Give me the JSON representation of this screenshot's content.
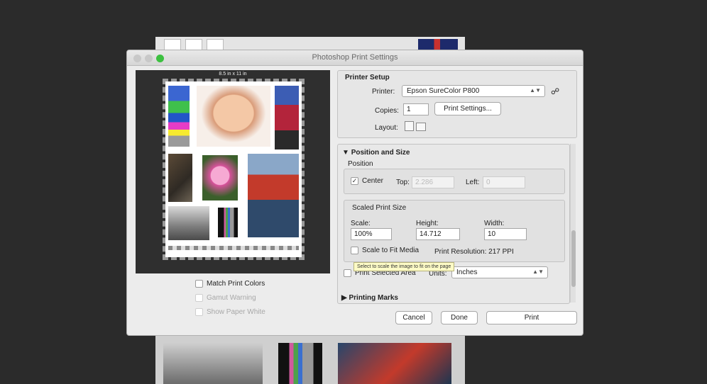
{
  "dialog": {
    "title": "Photoshop Print Settings"
  },
  "preview": {
    "paper_size": "8.5 in x 11 in",
    "match_print_colors": "Match Print Colors",
    "gamut_warning": "Gamut Warning",
    "show_paper_white": "Show Paper White"
  },
  "printer_setup": {
    "heading": "Printer Setup",
    "printer_label": "Printer:",
    "printer_value": "Epson SureColor P800",
    "copies_label": "Copies:",
    "copies_value": "1",
    "print_settings_button": "Print Settings...",
    "layout_label": "Layout:"
  },
  "position_size": {
    "heading": "Position and Size",
    "position_label": "Position",
    "center_label": "Center",
    "top_label": "Top:",
    "top_value": "2.286",
    "left_label": "Left:",
    "left_value": "0",
    "scaled_heading": "Scaled Print Size",
    "scale_label": "Scale:",
    "scale_value": "100%",
    "height_label": "Height:",
    "height_value": "14.712",
    "width_label": "Width:",
    "width_value": "10",
    "scale_to_fit": "Scale to Fit Media",
    "print_resolution": "Print Resolution: 217 PPI",
    "tooltip": "Select to scale the image to fit on the page",
    "print_selected_area": "Print Selected Area",
    "units_label": "Units:",
    "units_value": "Inches"
  },
  "printing_marks": {
    "heading": "Printing Marks"
  },
  "buttons": {
    "cancel": "Cancel",
    "done": "Done",
    "print": "Print"
  },
  "colors": {
    "accent": "#3cc040",
    "background": "#2b2b2b"
  }
}
